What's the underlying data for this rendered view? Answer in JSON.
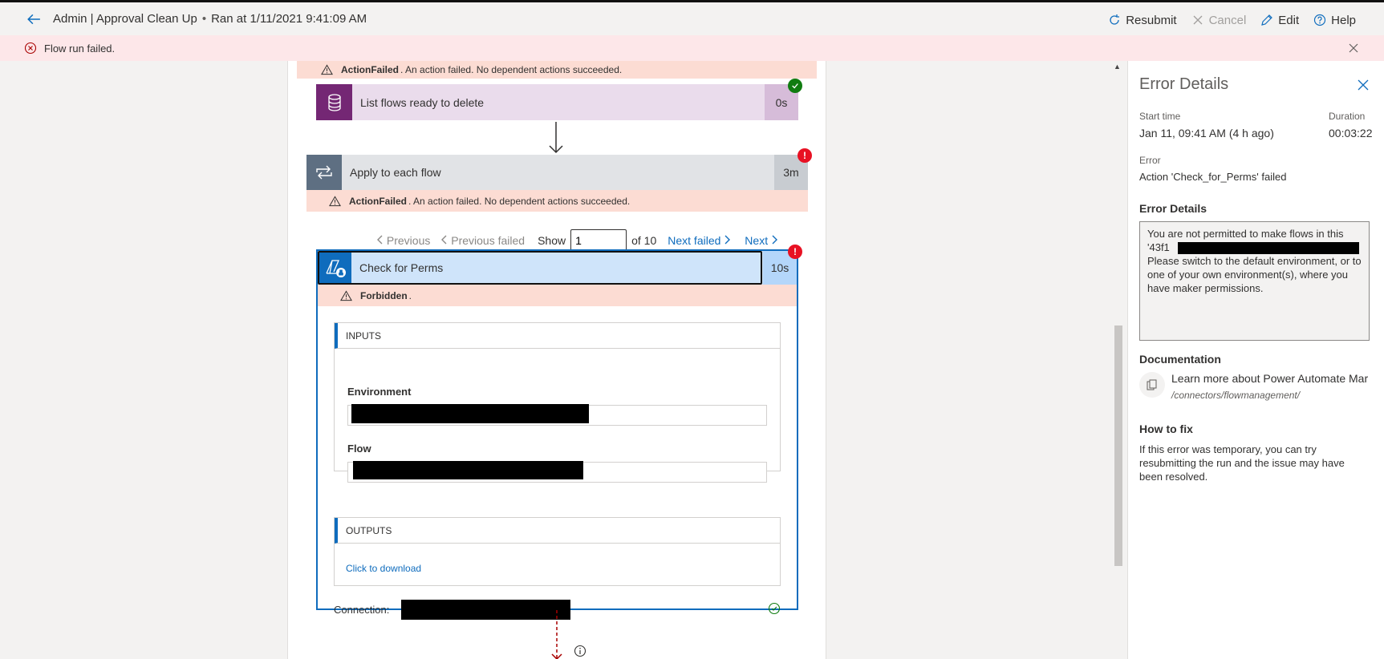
{
  "header": {
    "breadcrumb": "Admin | Approval Clean Up",
    "separator": "•",
    "run_info": "Ran at 1/11/2021 9:41:09 AM",
    "commands": {
      "resubmit": "Resubmit",
      "cancel": "Cancel",
      "edit": "Edit",
      "help": "Help"
    }
  },
  "error_bar": {
    "message": "Flow run failed."
  },
  "flow": {
    "top_banner": {
      "code": "ActionFailed",
      "text": ". An action failed. No dependent actions succeeded."
    },
    "list_step": {
      "title": "List flows ready to delete",
      "duration": "0s",
      "color": "#742774",
      "status": "succeeded"
    },
    "apply_step": {
      "title": "Apply to each flow",
      "duration": "3m",
      "status": "failed"
    },
    "apply_banner": {
      "code": "ActionFailed",
      "text": ". An action failed. No dependent actions succeeded."
    },
    "pager": {
      "previous": "Previous",
      "previous_failed": "Previous failed",
      "show": "Show",
      "value": "1",
      "of": "of 10",
      "next_failed": "Next failed",
      "next": "Next"
    },
    "check_step": {
      "title": "Check for Perms",
      "duration": "10s",
      "banner_code": "Forbidden",
      "banner_text": ".",
      "inputs_header": "INPUTS",
      "environment_label": "Environment",
      "flow_label": "Flow",
      "outputs_header": "OUTPUTS",
      "download_link": "Click to download",
      "connection_label": "Connection:"
    }
  },
  "error_panel": {
    "title": "Error Details",
    "start_time_label": "Start time",
    "start_time": "Jan 11, 09:41 AM (4 h ago)",
    "duration_label": "Duration",
    "duration": "00:03:22",
    "error_label": "Error",
    "error": "Action 'Check_for_Perms' failed",
    "details_header": "Error Details",
    "details_line1": "You are not permitted to make flows in this",
    "details_line2_prefix": "'43f1",
    "details_rest": "Please switch to the default environment, or to one of your own environment(s), where you have maker permissions.",
    "documentation_header": "Documentation",
    "doc_link": "Learn more about Power Automate Mar",
    "doc_path": "/connectors/flowmanagement/",
    "fix_header": "How to fix",
    "fix_text": "If this error was temporary, you can try resubmitting the run and the issue may have been resolved."
  },
  "colors": {
    "accent": "#0f6cbd",
    "error_banner": "#fcdcd3",
    "error_bar": "#fde7e9",
    "failed": "#e81123",
    "succeeded": "#107c10"
  }
}
